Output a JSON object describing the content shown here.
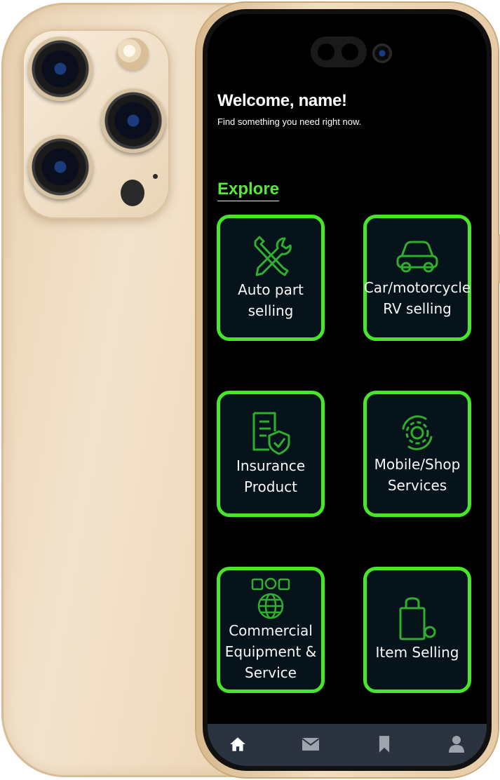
{
  "header": {
    "title": "Welcome, name!",
    "subtitle": "Find something you need right now."
  },
  "explore": {
    "heading": "Explore"
  },
  "categories": [
    {
      "label": "Auto part\nselling",
      "icon": "tools-icon"
    },
    {
      "label": "Car/motorcycle\nRV selling",
      "icon": "car-icon"
    },
    {
      "label": "Insurance\nProduct",
      "icon": "insurance-document-icon"
    },
    {
      "label": "Mobile/Shop\nServices",
      "icon": "gear-service-icon"
    },
    {
      "label": "Commercial\nEquipment &\nService",
      "icon": "global-commerce-icon"
    },
    {
      "label": "Item Selling",
      "icon": "shopping-bag-icon"
    }
  ],
  "bottom_nav": [
    {
      "icon": "home-icon"
    },
    {
      "icon": "mail-icon"
    },
    {
      "icon": "bookmark-icon"
    },
    {
      "icon": "profile-icon"
    }
  ],
  "colors": {
    "accent_green": "#48e62a",
    "card_background": "#06131a",
    "screen_background": "#000000",
    "nav_background": "#2b3240",
    "phone_gold": "#eed8bb"
  }
}
